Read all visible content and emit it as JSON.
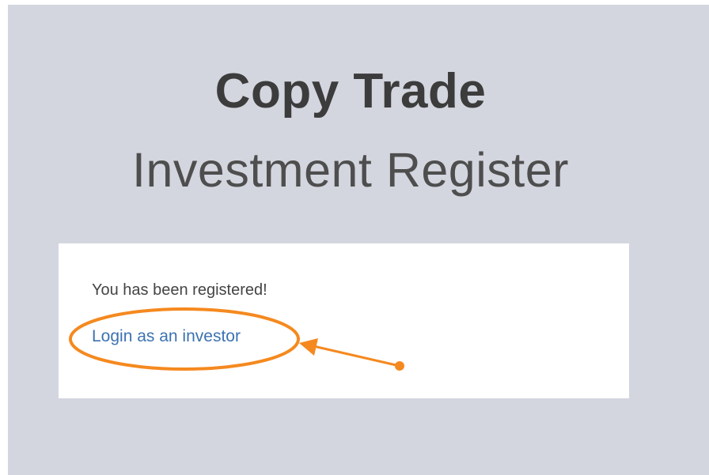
{
  "header": {
    "title": "Copy Trade",
    "subtitle": "Investment Register"
  },
  "card": {
    "message": "You has been registered!",
    "login_link": "Login as an investor"
  },
  "annotation": {
    "color": "#f5891f"
  }
}
